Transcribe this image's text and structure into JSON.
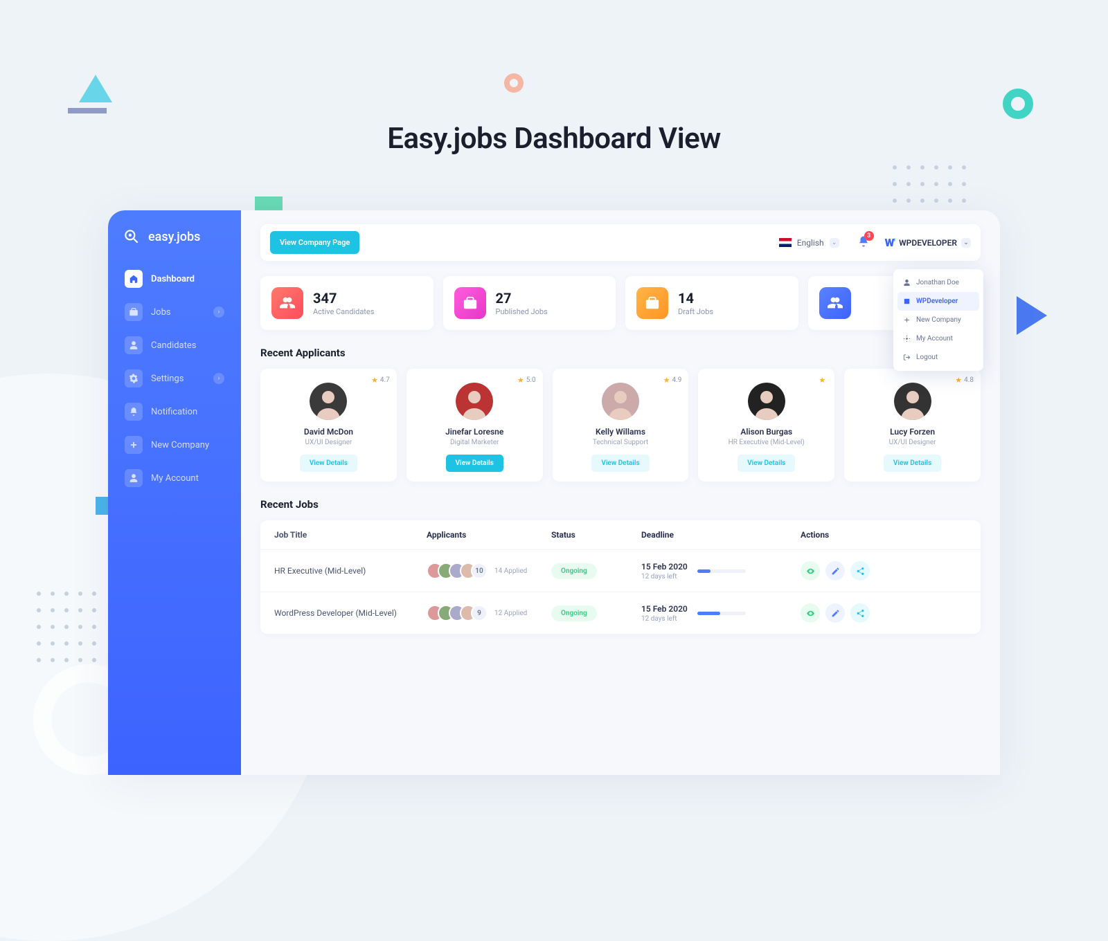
{
  "page_title": "Easy.jobs Dashboard View",
  "sidebar": {
    "brand": "easy.jobs",
    "items": [
      {
        "label": "Dashboard",
        "active": true,
        "chev": false
      },
      {
        "label": "Jobs",
        "active": false,
        "chev": true
      },
      {
        "label": "Candidates",
        "active": false,
        "chev": false
      },
      {
        "label": "Settings",
        "active": false,
        "chev": true
      },
      {
        "label": "Notification",
        "active": false,
        "chev": false
      },
      {
        "label": "New Company",
        "active": false,
        "chev": false
      },
      {
        "label": "My Account",
        "active": false,
        "chev": false
      }
    ]
  },
  "topbar": {
    "view_btn": "View Company Page",
    "lang": "English",
    "badge": "3",
    "company_name": "WPDEVELOPER"
  },
  "dropdown": {
    "items": [
      {
        "label": "Jonathan Doe"
      },
      {
        "label": "WPDeveloper"
      },
      {
        "label": "New Company"
      },
      {
        "label": "My Account"
      },
      {
        "label": "Logout"
      }
    ]
  },
  "stats": [
    {
      "num": "347",
      "label": "Active Candidates"
    },
    {
      "num": "27",
      "label": "Published Jobs"
    },
    {
      "num": "14",
      "label": "Draft Jobs"
    },
    {
      "num": "",
      "label": ""
    }
  ],
  "sections": {
    "applicants_title": "Recent Applicants",
    "jobs_title": "Recent Jobs"
  },
  "applicants": [
    {
      "name": "David McDon",
      "role": "UX/UI Designer",
      "rating": "4.7",
      "btn": "View Details",
      "solid": false
    },
    {
      "name": "Jinefar Loresne",
      "role": "Digital Marketer",
      "rating": "5.0",
      "btn": "View Details",
      "solid": true
    },
    {
      "name": "Kelly Willams",
      "role": "Technical Support",
      "rating": "4.9",
      "btn": "View Details",
      "solid": false
    },
    {
      "name": "Alison Burgas",
      "role": "HR Executive (Mid-Level)",
      "rating": "",
      "btn": "View Details",
      "solid": false
    },
    {
      "name": "Lucy Forzen",
      "role": "UX/UI Designer",
      "rating": "4.8",
      "btn": "View Details",
      "solid": false
    }
  ],
  "jobs_table": {
    "headers": {
      "title": "Job Title",
      "applicants": "Applicants",
      "status": "Status",
      "deadline": "Deadline",
      "actions": "Actions"
    },
    "rows": [
      {
        "title": "HR Executive (Mid-Level)",
        "count": "10",
        "applied": "14 Applied",
        "status": "Ongoing",
        "date": "15 Feb 2020",
        "left": "12 days left",
        "prog": 28
      },
      {
        "title": "WordPress Developer (Mid-Level)",
        "count": "9",
        "applied": "12 Applied",
        "status": "Ongoing",
        "date": "15 Feb 2020",
        "left": "12 days left",
        "prog": 48
      }
    ]
  }
}
